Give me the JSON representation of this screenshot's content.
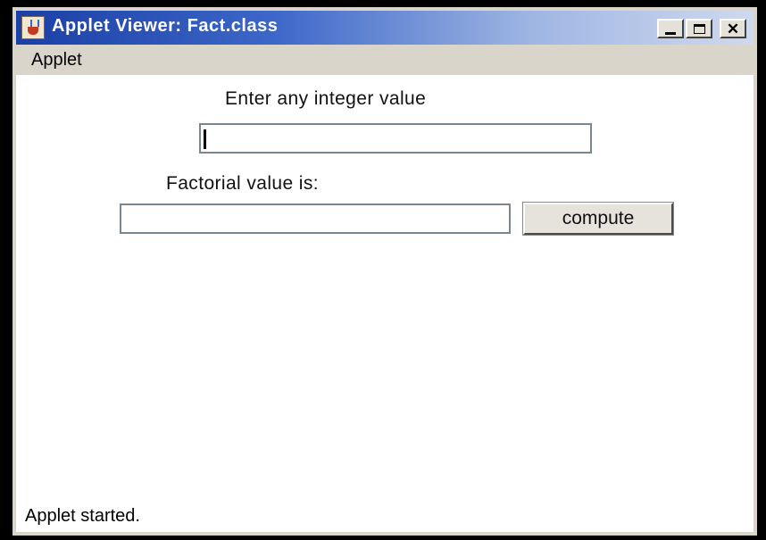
{
  "window": {
    "title": "Applet Viewer: Fact.class",
    "icon": "java-cup-icon"
  },
  "menu": {
    "items": [
      "Applet"
    ]
  },
  "form": {
    "input_label": "Enter any integer value",
    "input_value": "",
    "result_label": "Factorial value is:",
    "result_value": "",
    "compute_label": "compute"
  },
  "status": "Applet started."
}
